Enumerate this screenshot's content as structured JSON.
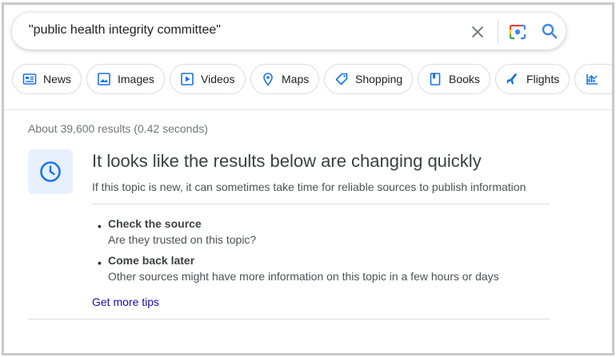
{
  "search": {
    "query": "\"public health integrity committee\""
  },
  "chips": [
    {
      "label": "News",
      "icon": "news-icon"
    },
    {
      "label": "Images",
      "icon": "image-icon"
    },
    {
      "label": "Videos",
      "icon": "video-icon"
    },
    {
      "label": "Maps",
      "icon": "map-pin-icon"
    },
    {
      "label": "Shopping",
      "icon": "tag-icon"
    },
    {
      "label": "Books",
      "icon": "book-icon"
    },
    {
      "label": "Flights",
      "icon": "plane-icon"
    },
    {
      "label": "",
      "icon": "finance-icon"
    }
  ],
  "results": {
    "stats": "About 39,600 results (0.42 seconds)"
  },
  "notice": {
    "icon": "clock-icon",
    "title": "It looks like the results below are changing quickly",
    "subtitle": "If this topic is new, it can sometimes take time for reliable sources to publish information",
    "tips": [
      {
        "title": "Check the source",
        "desc": "Are they trusted on this topic?"
      },
      {
        "title": "Come back later",
        "desc": "Other sources might have more information on this topic in a few hours or days"
      }
    ],
    "more_link": "Get more tips"
  },
  "colors": {
    "accent_blue": "#4285f4",
    "icon_blue": "#1a73e8",
    "link": "#1a0dab",
    "notice_bg": "#e8f0fe"
  }
}
